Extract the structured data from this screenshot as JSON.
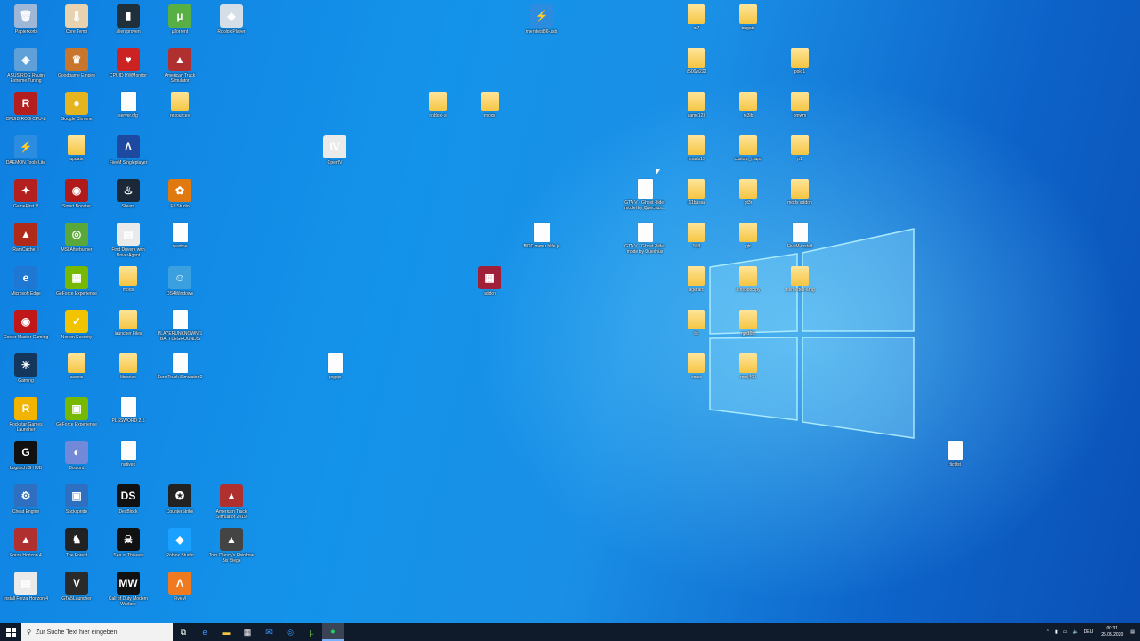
{
  "desktop_icons": [
    {
      "label": "Papierkorb",
      "type": "recycle",
      "glyph": "🗑",
      "color": "#9fb7d6"
    },
    {
      "label": "Core Temp",
      "type": "app",
      "glyph": "🌡",
      "color": "#e8d2b0"
    },
    {
      "label": "alien proven",
      "type": "app",
      "glyph": "▮",
      "color": "#20303a"
    },
    {
      "label": "µTorrent",
      "type": "app",
      "glyph": "µ",
      "color": "#58b044"
    },
    {
      "label": "Roblox Player",
      "type": "app",
      "glyph": "◆",
      "color": "#d5dde6"
    },
    {
      "label": "memtest86-usb",
      "type": "app",
      "glyph": "⚡",
      "color": "#2b8ce0"
    },
    {
      "label": "m7",
      "type": "folder"
    },
    {
      "label": "bugatti",
      "type": "folder"
    },
    {
      "label": "ASUS ROG Ryujin Extreme Tuning",
      "type": "app",
      "glyph": "◈",
      "color": "#5fa0d8"
    },
    {
      "label": "Goodgame Empire",
      "type": "app",
      "glyph": "♛",
      "color": "#c8762e"
    },
    {
      "label": "CPUID HWMonitor",
      "type": "app",
      "glyph": "♥",
      "color": "#cc2222"
    },
    {
      "label": "American Truck Simulator",
      "type": "app",
      "glyph": "▲",
      "color": "#b03030"
    },
    {
      "label": "c500w222",
      "type": "folder"
    },
    {
      "label": "polo1",
      "type": "folder"
    },
    {
      "label": "CPUID ROG CPU-Z",
      "type": "app",
      "glyph": "R",
      "color": "#b51e1e"
    },
    {
      "label": "Google Chrome",
      "type": "app",
      "glyph": "●",
      "color": "#e5b520"
    },
    {
      "label": "server.cfg",
      "type": "file"
    },
    {
      "label": "resources",
      "type": "folder"
    },
    {
      "label": "roblox-ui",
      "type": "folder"
    },
    {
      "label": "mods",
      "type": "folder"
    },
    {
      "label": "sams123",
      "type": "folder"
    },
    {
      "label": "rs3lb",
      "type": "folder"
    },
    {
      "label": "bmwm",
      "type": "folder"
    },
    {
      "label": "DAEMON Tools Lite",
      "type": "app",
      "glyph": "⚡",
      "color": "#2b8ce0"
    },
    {
      "label": "update",
      "type": "folder"
    },
    {
      "label": "FiveM Singleplayer",
      "type": "app",
      "glyph": "Λ",
      "color": "#1d4aa0"
    },
    {
      "label": "OpenIV",
      "type": "app",
      "glyph": "IV",
      "color": "#eaeaea"
    },
    {
      "label": "rmasb19",
      "type": "folder"
    },
    {
      "label": "custom_maps",
      "type": "folder"
    },
    {
      "label": "p1",
      "type": "folder"
    },
    {
      "label": "GameFirst V",
      "type": "app",
      "glyph": "✦",
      "color": "#b41f1f"
    },
    {
      "label": "Smart Booster",
      "type": "app",
      "glyph": "◉",
      "color": "#b01a1a"
    },
    {
      "label": "Steam",
      "type": "app",
      "glyph": "♨",
      "color": "#1b2838"
    },
    {
      "label": "FL Studio",
      "type": "app",
      "glyph": "✿",
      "color": "#e07a10"
    },
    {
      "label": "GTA V - Ghost Rider model by Quechus...",
      "type": "file"
    },
    {
      "label": "r11bussa",
      "type": "folder"
    },
    {
      "label": "gt3r",
      "type": "folder"
    },
    {
      "label": "mods addon",
      "type": "folder"
    },
    {
      "label": "RamCache II",
      "type": "app",
      "glyph": "▲",
      "color": "#b02a1a"
    },
    {
      "label": "MSI Afterburner",
      "type": "app",
      "glyph": "◎",
      "color": "#5aa83a"
    },
    {
      "label": "Find Drivers with DriverAgent",
      "type": "app",
      "glyph": "▤",
      "color": "#eaeaea"
    },
    {
      "label": "readme",
      "type": "file"
    },
    {
      "label": "MOD menu hilfe.js",
      "type": "file"
    },
    {
      "label": "GTA V - Ghost Rider mode by Quechus",
      "type": "file"
    },
    {
      "label": "918",
      "type": "folder"
    },
    {
      "label": "gtr",
      "type": "folder"
    },
    {
      "label": "FiveM-install",
      "type": "file"
    },
    {
      "label": "Microsoft Edge",
      "type": "app",
      "glyph": "e",
      "color": "#1f77d4"
    },
    {
      "label": "GeForce Experience",
      "type": "app",
      "glyph": "▦",
      "color": "#76b900"
    },
    {
      "label": "mods",
      "type": "folder"
    },
    {
      "label": "DS4Windows",
      "type": "app",
      "glyph": "☺",
      "color": "#3aa0e0"
    },
    {
      "label": "addon",
      "type": "app",
      "glyph": "▦",
      "color": "#a0203a"
    },
    {
      "label": "agerarc",
      "type": "folder"
    },
    {
      "label": "hotspotcopy",
      "type": "folder"
    },
    {
      "label": "mercedes-amg",
      "type": "folder"
    },
    {
      "label": "Cooler Master Gaming",
      "type": "app",
      "glyph": "◉",
      "color": "#c01818"
    },
    {
      "label": "Norton Security",
      "type": "app",
      "glyph": "✓",
      "color": "#f2c400"
    },
    {
      "label": "launcher.Files",
      "type": "folder"
    },
    {
      "label": "PLAYERUNKNOWN'S BATTLEGROUNDS",
      "type": "file"
    },
    {
      "label": "bc",
      "type": "folder"
    },
    {
      "label": "rgs10lc",
      "type": "folder"
    },
    {
      "label": "Gaming",
      "type": "app",
      "glyph": "✳",
      "color": "#14365c"
    },
    {
      "label": "assets",
      "type": "folder"
    },
    {
      "label": "libraries",
      "type": "folder"
    },
    {
      "label": "Euro Truck Simulator 2",
      "type": "file"
    },
    {
      "label": "gogojs",
      "type": "file"
    },
    {
      "label": "cmcc",
      "type": "folder"
    },
    {
      "label": "mrsj400",
      "type": "folder"
    },
    {
      "label": "Rockstar Games Launcher",
      "type": "app",
      "glyph": "R",
      "color": "#f2b400"
    },
    {
      "label": "GeForce Experience",
      "type": "app",
      "glyph": "▣",
      "color": "#76b900"
    },
    {
      "label": "PLSSWORD 2.5",
      "type": "file"
    },
    {
      "label": "Logitech G HUB",
      "type": "app",
      "glyph": "G",
      "color": "#111111"
    },
    {
      "label": "Discord",
      "type": "app",
      "glyph": "◐",
      "color": "#7289da"
    },
    {
      "label": "natives",
      "type": "file"
    },
    {
      "label": "dictlist",
      "type": "file"
    },
    {
      "label": "Cheat Engine",
      "type": "app",
      "glyph": "⚙",
      "color": "#2f6fc0"
    },
    {
      "label": "Stickspride",
      "type": "app",
      "glyph": "▣",
      "color": "#2f6fc0"
    },
    {
      "label": "DesBlock",
      "type": "app",
      "glyph": "DS",
      "color": "#111111"
    },
    {
      "label": "CounterStrike",
      "type": "app",
      "glyph": "✪",
      "color": "#222222"
    },
    {
      "label": "American Truck Simulator 2019",
      "type": "app",
      "glyph": "▲",
      "color": "#b03030"
    },
    {
      "label": "Forza Horizon 4",
      "type": "app",
      "glyph": "▲",
      "color": "#b03030"
    },
    {
      "label": "The Forest",
      "type": "app",
      "glyph": "♞",
      "color": "#222222"
    },
    {
      "label": "Sea of Thieves",
      "type": "app",
      "glyph": "☠",
      "color": "#111111"
    },
    {
      "label": "Roblox Studio",
      "type": "app",
      "glyph": "◆",
      "color": "#1aa0ff"
    },
    {
      "label": "Tom Clancy's Rainbow Six Siege",
      "type": "app",
      "glyph": "▲",
      "color": "#444444"
    },
    {
      "label": "Install Forza Horizon 4",
      "type": "app",
      "glyph": "▤",
      "color": "#eaeaea"
    },
    {
      "label": "GTA5Launcher",
      "type": "app",
      "glyph": "V",
      "color": "#2a2a2a"
    },
    {
      "label": "Call of Duty Modern Warfare",
      "type": "app",
      "glyph": "MW",
      "color": "#111111"
    },
    {
      "label": "FiveM",
      "type": "app",
      "glyph": "Λ",
      "color": "#f07a20"
    }
  ],
  "taskbar": {
    "search_placeholder": "Zur Suche Text hier eingeben",
    "language": "DEU",
    "time": "00:31",
    "date": "25.05.2020",
    "pinned": [
      {
        "name": "task-view",
        "glyph": "⧉"
      },
      {
        "name": "edge",
        "glyph": "e"
      },
      {
        "name": "file-explorer",
        "glyph": "▬"
      },
      {
        "name": "store",
        "glyph": "▦"
      },
      {
        "name": "mail",
        "glyph": "✉"
      },
      {
        "name": "messenger",
        "glyph": "◎"
      },
      {
        "name": "utorrent",
        "glyph": "µ"
      },
      {
        "name": "spotify",
        "glyph": "●"
      }
    ]
  }
}
